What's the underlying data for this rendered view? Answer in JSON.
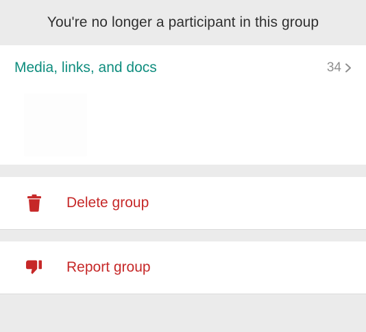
{
  "banner": {
    "text": "You're no longer a participant in this group"
  },
  "media": {
    "title": "Media, links, and docs",
    "count": "34",
    "chevron_icon": "chevron-right-icon"
  },
  "actions": [
    {
      "label": "Delete group",
      "icon": "trash-icon",
      "color": "#c62828"
    },
    {
      "label": "Report group",
      "icon": "thumbs-down-icon",
      "color": "#c62828"
    }
  ],
  "colors": {
    "accent_teal": "#0f8d7e",
    "danger_red": "#c62828",
    "background_gray": "#ebebeb",
    "muted_gray": "#8e8e8e"
  }
}
